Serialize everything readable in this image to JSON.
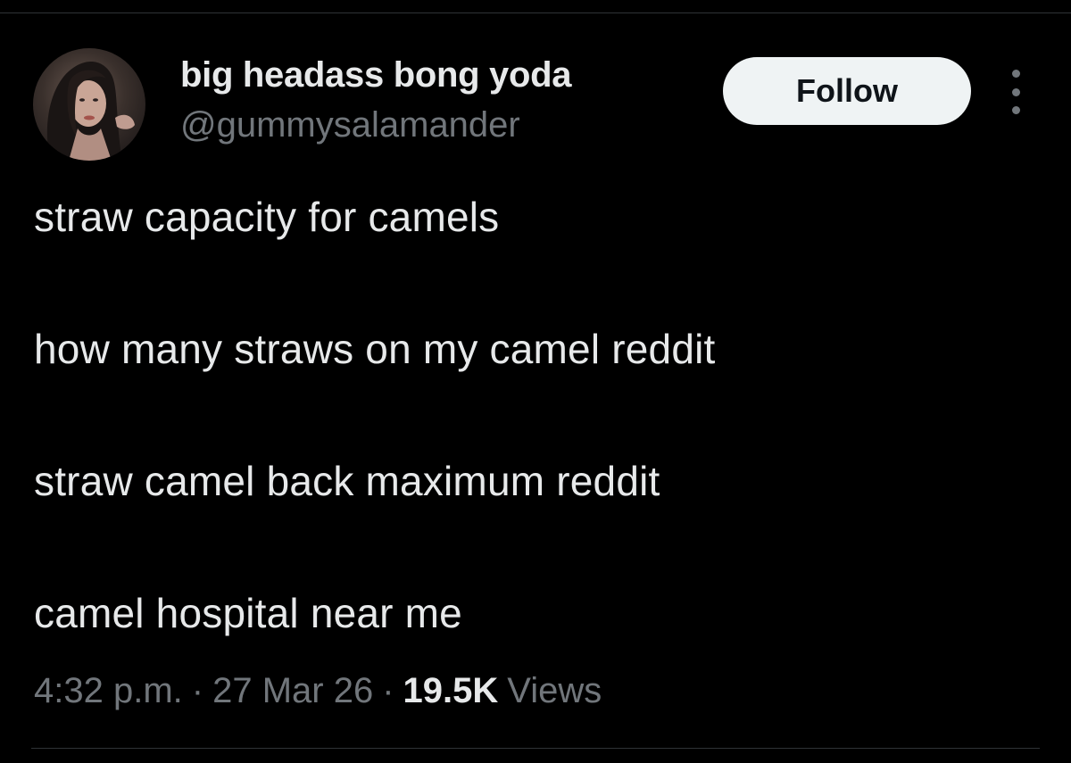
{
  "author": {
    "display_name": "big headass bong yoda",
    "handle": "@gummysalamander"
  },
  "header": {
    "follow_label": "Follow",
    "more_icon": "more-vertical-icon"
  },
  "tweet": {
    "lines": [
      "straw capacity for camels",
      "how many straws on my camel reddit",
      "straw camel back maximum reddit",
      "camel hospital near me"
    ]
  },
  "meta": {
    "time": "4:32 p.m.",
    "separator": "·",
    "date": "27 Mar 26",
    "views_count": "19.5K",
    "views_label": "Views"
  },
  "colors": {
    "background": "#000000",
    "text_primary": "#e7e9ea",
    "text_secondary": "#71767b",
    "follow_button_bg": "#eff3f4",
    "follow_button_text": "#0f1419",
    "divider": "#2f3336"
  }
}
